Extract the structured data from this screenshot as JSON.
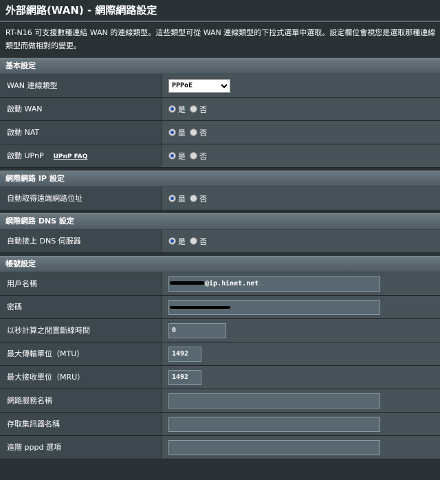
{
  "page": {
    "title": "外部網路(WAN) - 網際網路設定",
    "description": "RT-N16 可支援數種連結 WAN 的連線類型。這些類型可從 WAN 連線類型的下拉式選單中選取。設定欄位會視您是選取那種連線類型而做相對的變更。"
  },
  "basic": {
    "heading": "基本設定",
    "wan_type_label": "WAN 連線類型",
    "wan_type_value": "PPPoE",
    "enable_wan_label": "啟動 WAN",
    "enable_nat_label": "啟動 NAT",
    "enable_upnp_label": "啟動 UPnP",
    "upnp_faq": "UPnP FAQ"
  },
  "ip": {
    "heading": "網際網路 IP 設定",
    "auto_ip_label": "自動取得遠端網路位址"
  },
  "dns": {
    "heading": "網際網路 DNS 設定",
    "auto_dns_label": "自動接上 DNS 伺服器"
  },
  "account": {
    "heading": "帳號設定",
    "username_label": "用戶名稱",
    "username_value": "@ip.hinet.net",
    "password_label": "密碼",
    "idle_label": "以秒計算之閒置斷線時間",
    "idle_value": "0",
    "mtu_label": "最大傳輸單位（MTU）",
    "mtu_value": "1492",
    "mru_label": "最大接收單位（MRU）",
    "mru_value": "1492",
    "service_label": "網路服務名稱",
    "service_value": "",
    "ac_label": "存取集訊器名稱",
    "ac_value": "",
    "pppd_label": "進階 pppd 選項",
    "pppd_value": ""
  },
  "radio": {
    "yes": "是",
    "no": "否"
  }
}
